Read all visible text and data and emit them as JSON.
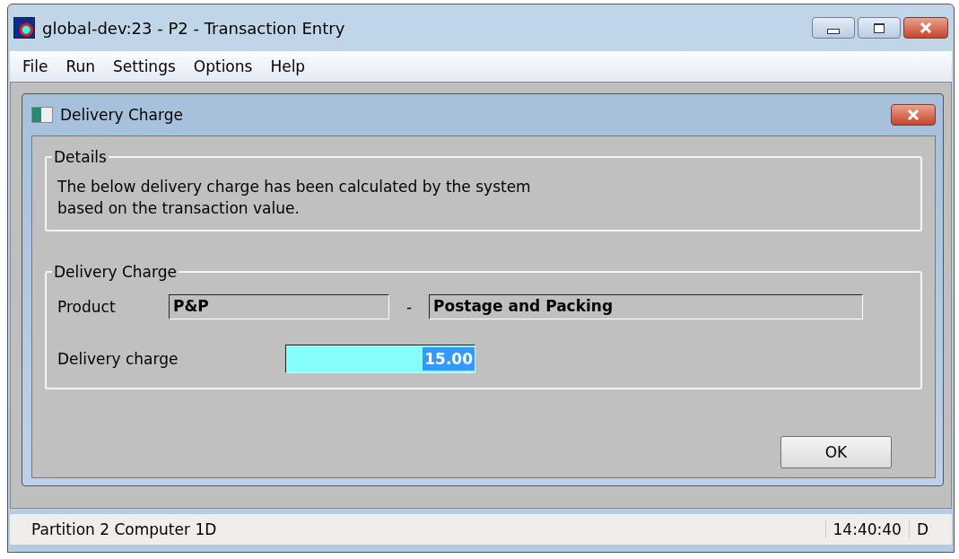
{
  "window": {
    "title": "global-dev:23 - P2 - Transaction Entry"
  },
  "menu": [
    "File",
    "Run",
    "Settings",
    "Options",
    "Help"
  ],
  "dialog": {
    "title": "Delivery Charge",
    "details": {
      "heading": "Details",
      "lines": [
        "The below delivery charge has been calculated by the system",
        "based on the transaction value."
      ]
    },
    "charge": {
      "heading": "Delivery Charge",
      "product_label": "Product",
      "product_code": "P&P",
      "separator": "-",
      "product_name": "Postage and Packing",
      "charge_label": "Delivery charge",
      "charge_value": "15.00"
    },
    "buttons": [
      "OK"
    ]
  },
  "status_bar": {
    "left": "Partition 2 Computer 1D",
    "time": "14:40:40",
    "mode": "D"
  }
}
